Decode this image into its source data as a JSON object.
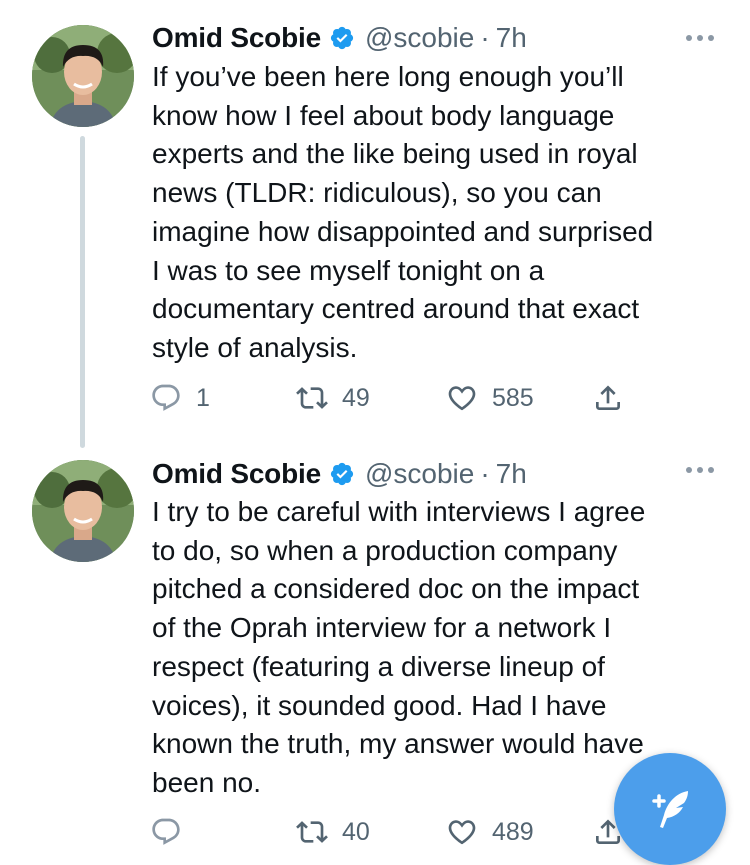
{
  "tweets": [
    {
      "display_name": "Omid Scobie",
      "handle": "@scobie",
      "separator": "·",
      "time": "7h",
      "text": "If you’ve been here long enough you’ll\nknow how I feel about body language\nexperts and the like being used in royal\nnews (TLDR: ridiculous), so you can\nimagine how disappointed and surprised\nI was to see myself tonight on a\ndocumentary centred around that exact\nstyle of analysis.",
      "replies": "1",
      "retweets": "49",
      "likes": "585"
    },
    {
      "display_name": "Omid Scobie",
      "handle": "@scobie",
      "separator": "·",
      "time": "7h",
      "text": "I try to be careful with interviews I agree\nto do, so when a production company\npitched a considered doc on the impact\nof the Oprah interview for a network I\nrespect (featuring a diverse lineup of\nvoices), it sounded good. Had I have\nknown the truth, my answer would have\nbeen no.",
      "replies": "",
      "retweets": "40",
      "likes": "489"
    }
  ],
  "icons": {
    "verified": "verified-badge-icon",
    "reply": "reply-icon",
    "retweet": "retweet-icon",
    "like": "heart-icon",
    "share": "share-icon",
    "more": "more-icon",
    "compose": "compose-tweet-icon"
  },
  "colors": {
    "accent": "#4c9eeb",
    "verified": "#1d9bf0",
    "secondary_text": "#536471"
  }
}
